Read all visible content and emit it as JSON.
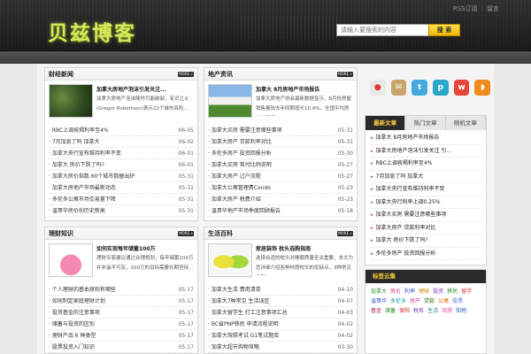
{
  "header": {
    "logo": "贝兹博客",
    "rss_label": "RSS订阅",
    "menu_label": "留言",
    "search_placeholder": "请输入要搜索的内容",
    "search_button": "搜 索"
  },
  "panels": [
    {
      "title": "财经新闻",
      "more": "MORE »",
      "feature_title": "加拿大房地产泡沫引发关注...",
      "feature_desc": "加拿大房地产泡沫随时可能破裂，有识之士 (Gregor Robertson)表示22个城市风险...",
      "items": [
        {
          "t": "RBC上调按揭利率至4%",
          "d": "06-05"
        },
        {
          "t": "7月加息了吗 加拿大",
          "d": "06-02"
        },
        {
          "t": "加拿大央行宣布维持利率不变",
          "d": "06-01"
        },
        {
          "t": "加拿大 房价下跌了吗?",
          "d": "06-01"
        },
        {
          "t": "加拿大房价指数 60个城市数据出炉",
          "d": "05-31"
        },
        {
          "t": "加拿大房地产市场最新动态",
          "d": "05-31"
        },
        {
          "t": "多伦多公寓市场交易量下降",
          "d": "05-31"
        },
        {
          "t": "温哥华房价创历史新高",
          "d": "05-31"
        }
      ]
    },
    {
      "title": "地产资讯",
      "more": "MORE »",
      "feature_title": "加拿大 8月房地产市场报告",
      "feature_desc": "加拿大房地产协会最新数据显示，8月份房屋销售量较去年同期增长10.4%，全国平均房价上涨至5...",
      "items": [
        {
          "t": "加拿大买房 需要注意哪些事项",
          "d": "05-31"
        },
        {
          "t": "加拿大房产 贷款利率对比",
          "d": "05-31"
        },
        {
          "t": "多伦多房产 投资回报分析",
          "d": "05-30"
        },
        {
          "t": "加拿大买房 首付比例说明",
          "d": "05-27"
        },
        {
          "t": "加拿大房产 过户流程",
          "d": "05-27"
        },
        {
          "t": "加拿大公寓管理费Condo",
          "d": "05-23"
        },
        {
          "t": "加拿大房产 税费介绍",
          "d": "05-23"
        },
        {
          "t": "温哥华地产市场季度回顾报告",
          "d": "05-18"
        }
      ]
    },
    {
      "title": "理财知识",
      "more": "MORE »",
      "feature_title": "如何实现每年储蓄100万",
      "feature_desc": "理财专家建议通过合理规划，每年储蓄100万并非遥不可及，100万的目标需要长期坚持...",
      "items": [
        {
          "t": "个人理财的基本原则有哪些",
          "d": "05-17"
        },
        {
          "t": "如何制定家庭理财计划",
          "d": "05-17"
        },
        {
          "t": "投资基金的注意事项",
          "d": "05-17"
        },
        {
          "t": "储蓄与投资的区别",
          "d": "05-17"
        },
        {
          "t": "理财产品 6 种类型",
          "d": "05-17"
        },
        {
          "t": "股票投资入门知识",
          "d": "05-17"
        }
      ]
    },
    {
      "title": "生活百科",
      "more": "MORE »",
      "feature_title": "家居装饰 枕头选购指南",
      "feature_desc": "选择合适的枕头对睡眠质量至关重要，本文为您详细介绍各种材质枕头的优缺点，3种常见类型...",
      "items": [
        {
          "t": "加拿大生活 费用清单",
          "d": "04-10"
        },
        {
          "t": "加拿大7种常见 生活误区",
          "d": "04-07"
        },
        {
          "t": "加拿大留学生 打工注意事项汇总",
          "d": "04-03"
        },
        {
          "t": "BC省PNP移民 申请流程说明",
          "d": "04-02"
        },
        {
          "t": "加拿大驾照考试 G1笔试题库",
          "d": "04-02"
        },
        {
          "t": "加拿大超市购物攻略",
          "d": "03-30"
        }
      ]
    }
  ],
  "social_icons": [
    "qq-icon",
    "mail-icon",
    "twitter-icon",
    "pinterest-icon",
    "weibo-icon",
    "rss-icon"
  ],
  "sidebar": {
    "tabs": [
      "最新文章",
      "热门文章",
      "随机文章"
    ],
    "items": [
      "加拿大 8月房地产市场报告",
      "加拿大房地产泡沫引发关注 引...",
      "RBC上调按揭利率至4%",
      "7月加息了吗 加拿大",
      "加拿大央行宣布维持利率不变",
      "加拿大央行利率上调0.25%",
      "加拿大买房 需要注意哪些事项",
      "加拿大房产 贷款利率对比",
      "加拿大 房价下跌了吗?",
      "多伦多房产 投资回报分析"
    ]
  },
  "tag_cloud": {
    "title": "标签云集",
    "tags": [
      {
        "t": "加拿大",
        "c": "#2a8a2a"
      },
      {
        "t": "房价",
        "c": "#d23a8a"
      },
      {
        "t": "利率",
        "c": "#3355cc"
      },
      {
        "t": "理财",
        "c": "#cc8800"
      },
      {
        "t": "投资",
        "c": "#8833bb"
      },
      {
        "t": "移民",
        "c": "#2a8a2a"
      },
      {
        "t": "留学",
        "c": "#dd3333"
      },
      {
        "t": "温哥华",
        "c": "#3355cc"
      },
      {
        "t": "多伦多",
        "c": "#1a9999"
      },
      {
        "t": "房产",
        "c": "#cc3399"
      },
      {
        "t": "贷款",
        "c": "#336600"
      },
      {
        "t": "公寓",
        "c": "#dd6600"
      },
      {
        "t": "股票",
        "c": "#5577dd"
      },
      {
        "t": "基金",
        "c": "#aa2255"
      },
      {
        "t": "储蓄",
        "c": "#2a8a2a"
      },
      {
        "t": "保险",
        "c": "#cc3333"
      },
      {
        "t": "税务",
        "c": "#7744cc"
      },
      {
        "t": "生活",
        "c": "#228888"
      },
      {
        "t": "驾照",
        "c": "#dd55aa"
      },
      {
        "t": "购物",
        "c": "#3366cc"
      }
    ]
  }
}
